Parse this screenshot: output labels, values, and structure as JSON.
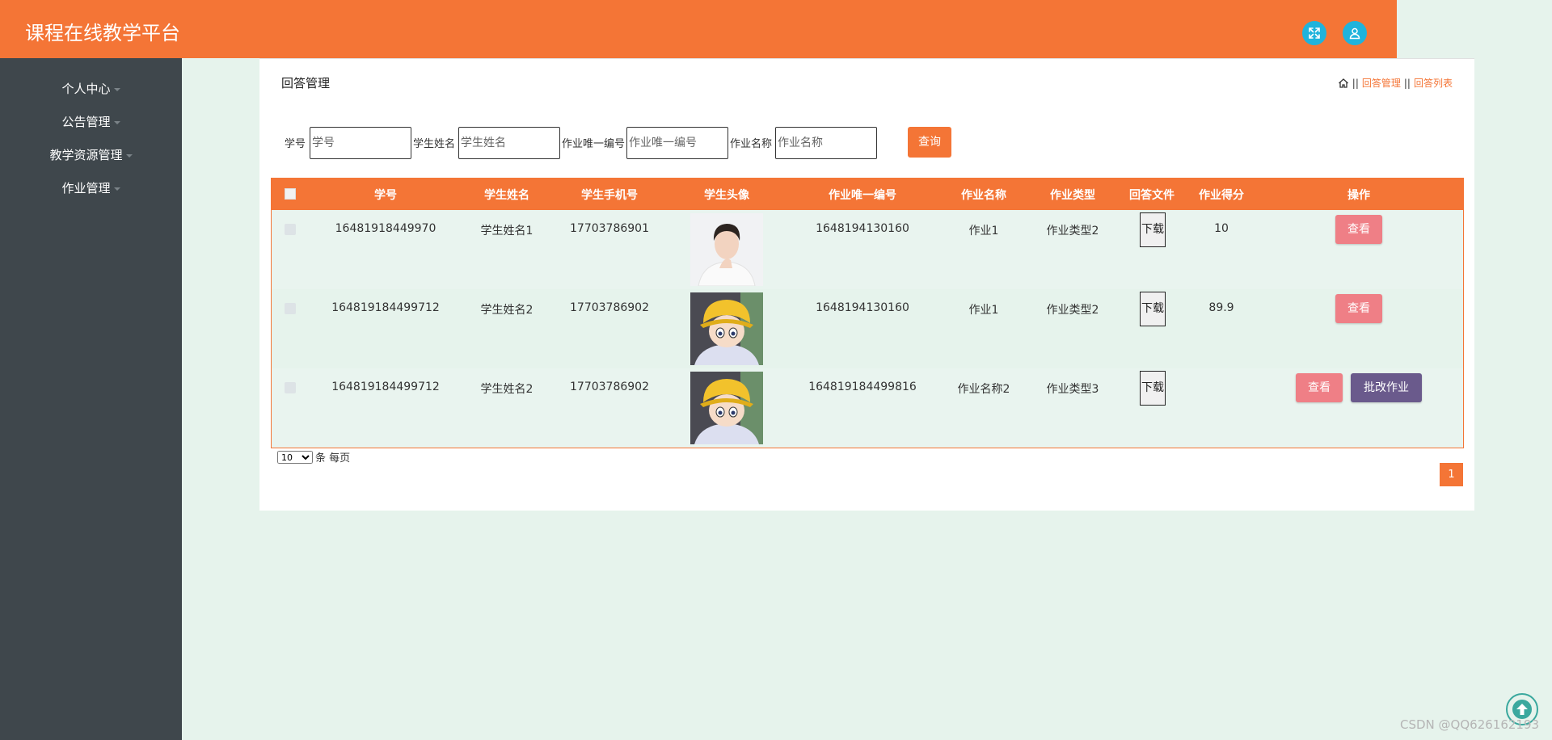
{
  "header": {
    "title": "课程在线教学平台",
    "icons": [
      "fullscreen-icon",
      "user-icon"
    ],
    "bg_color": "#f47536"
  },
  "sidebar": {
    "items": [
      {
        "label": "个人中心"
      },
      {
        "label": "公告管理"
      },
      {
        "label": "教学资源管理"
      },
      {
        "label": "作业管理"
      }
    ]
  },
  "page": {
    "title": "回答管理",
    "breadcrumb": [
      "回答管理",
      "回答列表"
    ],
    "breadcrumb_sep": "||"
  },
  "search": {
    "fields": [
      {
        "label": "学号",
        "placeholder": "学号"
      },
      {
        "label": "学生姓名",
        "placeholder": "学生姓名"
      },
      {
        "label": "作业唯一编号",
        "placeholder": "作业唯一编号"
      },
      {
        "label": "作业名称",
        "placeholder": "作业名称"
      }
    ],
    "button": "查询"
  },
  "table": {
    "columns": [
      "学号",
      "学生姓名",
      "学生手机号",
      "学生头像",
      "作业唯一编号",
      "作业名称",
      "作业类型",
      "回答文件",
      "作业得分",
      "操作"
    ],
    "rows": [
      {
        "student_id": "16481918449970",
        "name": "学生姓名1",
        "phone": "17703786901",
        "avatar": "young-man-photo",
        "hw_id": "1648194130160",
        "hw_name": "作业1",
        "hw_type": "作业类型2",
        "file": "下载",
        "score": "10",
        "actions": [
          "查看"
        ]
      },
      {
        "student_id": "164819184499712",
        "name": "学生姓名2",
        "phone": "17703786902",
        "avatar": "anime-child-yellow-hat",
        "hw_id": "1648194130160",
        "hw_name": "作业1",
        "hw_type": "作业类型2",
        "file": "下载",
        "score": "89.9",
        "actions": [
          "查看"
        ]
      },
      {
        "student_id": "164819184499712",
        "name": "学生姓名2",
        "phone": "17703786902",
        "avatar": "anime-child-yellow-hat",
        "hw_id": "164819184499816",
        "hw_name": "作业名称2",
        "hw_type": "作业类型3",
        "file": "下载",
        "score": "",
        "actions": [
          "查看",
          "批改作业"
        ]
      }
    ]
  },
  "pagination": {
    "page_size": "10",
    "page_size_suffix": "条 每页",
    "current_page": "1"
  },
  "watermark": "CSDN @QQ626162193",
  "colors": {
    "accent": "#f47536",
    "sidebar": "#3f474c",
    "view_button": "#ef7f86",
    "grade_button": "#6a5a8c",
    "icon_button": "#1fb3dc"
  }
}
